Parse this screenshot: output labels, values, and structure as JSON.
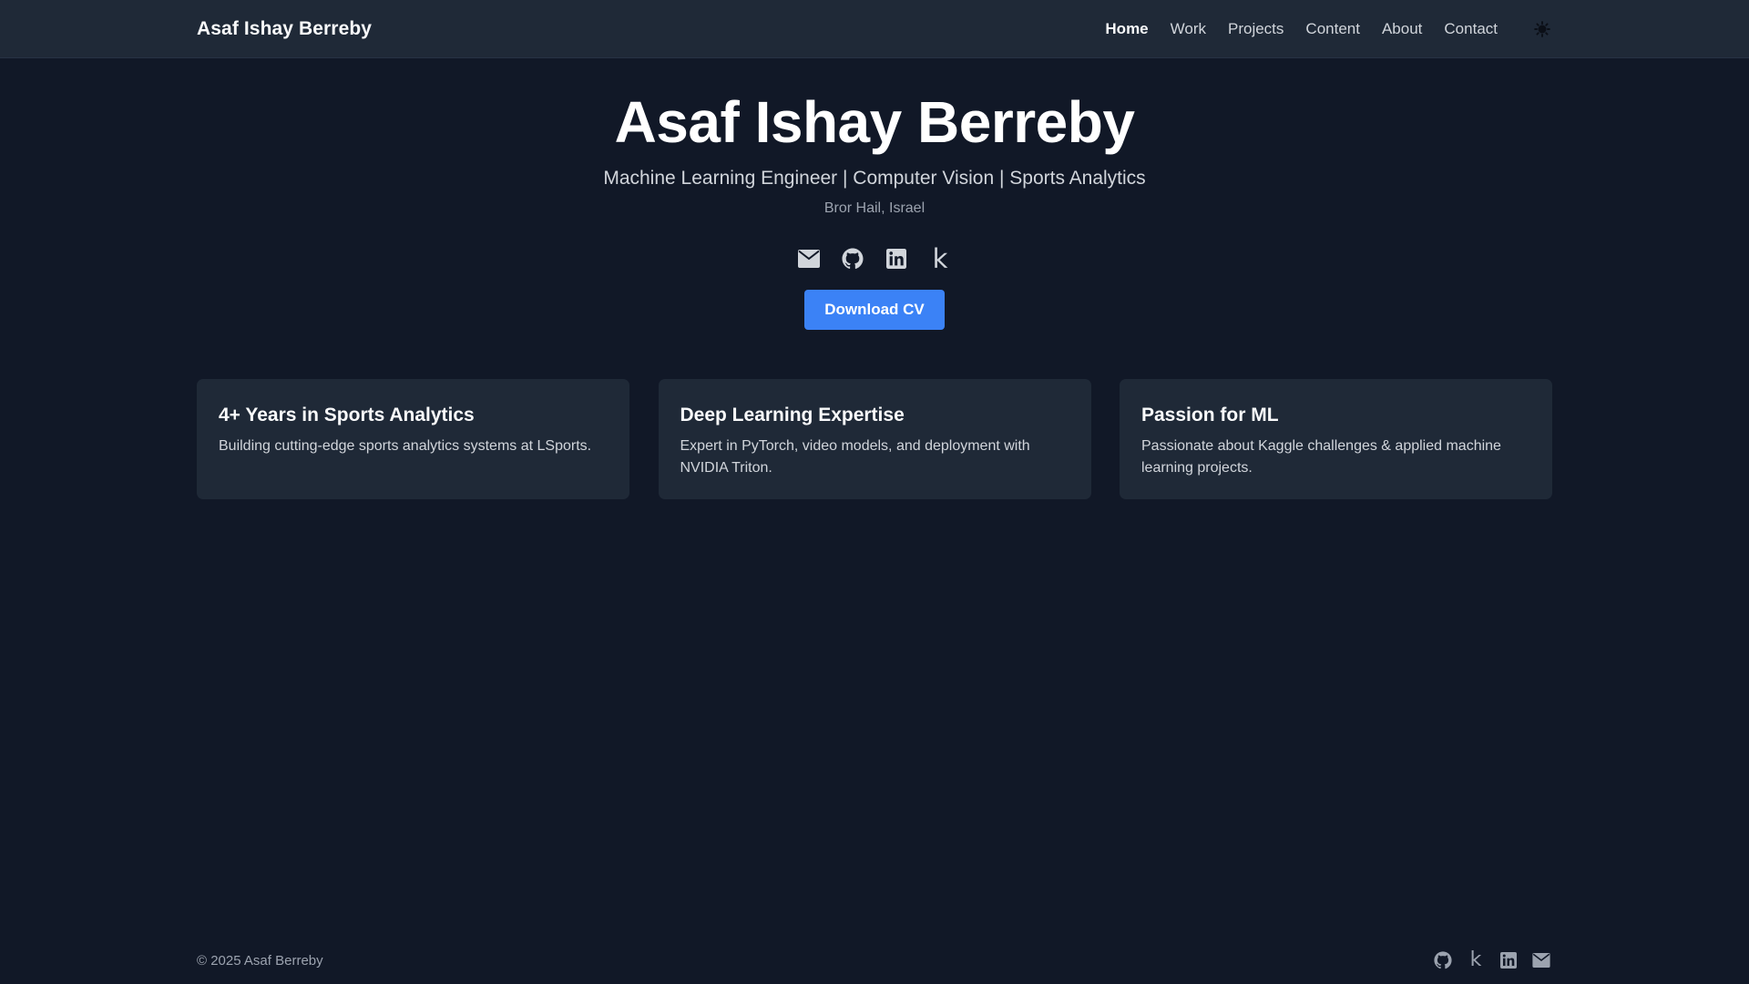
{
  "navbar": {
    "brand": "Asaf Ishay Berreby",
    "links": [
      {
        "label": "Home",
        "active": true
      },
      {
        "label": "Work",
        "active": false
      },
      {
        "label": "Projects",
        "active": false
      },
      {
        "label": "Content",
        "active": false
      },
      {
        "label": "About",
        "active": false
      },
      {
        "label": "Contact",
        "active": false
      }
    ],
    "theme_toggle_icon": "sun-icon"
  },
  "hero": {
    "name": "Asaf Ishay Berreby",
    "tagline": "Machine Learning Engineer | Computer Vision | Sports Analytics",
    "location": "Bror Hail, Israel",
    "social_icons": [
      "email-icon",
      "github-icon",
      "linkedin-icon",
      "kaggle-icon"
    ],
    "kaggle_glyph": "k",
    "cv_button_label": "Download CV"
  },
  "cards": [
    {
      "title": "4+ Years in Sports Analytics",
      "description": "Building cutting-edge sports analytics systems at LSports."
    },
    {
      "title": "Deep Learning Expertise",
      "description": "Expert in PyTorch, video models, and deployment with NVIDIA Triton."
    },
    {
      "title": "Passion for ML",
      "description": "Passionate about Kaggle challenges & applied machine learning projects."
    }
  ],
  "footer": {
    "copyright": "© 2025 Asaf Berreby",
    "icons": [
      "github-icon",
      "kaggle-icon",
      "linkedin-icon",
      "email-icon"
    ],
    "kaggle_glyph": "k"
  },
  "colors": {
    "background": "#111827",
    "surface": "#1f2937",
    "accent": "#3b82f6",
    "text_primary": "#f9fafb",
    "text_secondary": "#d1d5db",
    "text_muted": "#9ca3af"
  }
}
